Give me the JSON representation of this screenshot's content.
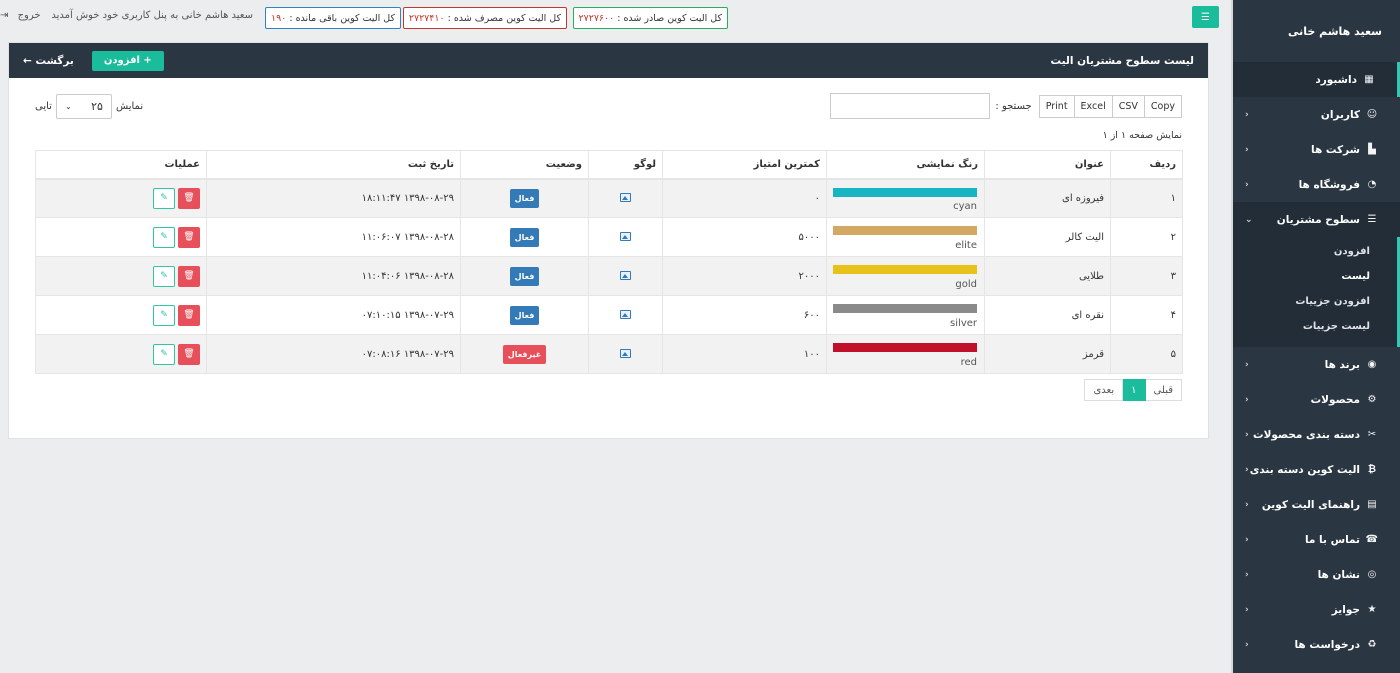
{
  "topbar": {
    "stat_issued_label": "کل الیت کوین صادر شده :",
    "stat_issued_value": "۲۷۲۷۶۰۰",
    "stat_used_label": "کل الیت کوین مصرف شده :",
    "stat_used_value": "۲۷۲۷۴۱۰",
    "stat_remaining_label": "کل الیت کوین باقی مانده :",
    "stat_remaining_value": "۱۹۰",
    "welcome": "سعید هاشم خانی به پنل کاربری خود خوش آمدید",
    "logout": "خروج"
  },
  "sidebar": {
    "user_name": "سعید هاشم خانی",
    "items": [
      {
        "label": "داشبورد",
        "icon": "▦"
      },
      {
        "label": "کاربران",
        "icon": "☺"
      },
      {
        "label": "شرکت ها",
        "icon": "▙"
      },
      {
        "label": "فروشگاه ها",
        "icon": "◔"
      },
      {
        "label": "سطوح مشتریان",
        "icon": "☰"
      },
      {
        "label": "برند ها",
        "icon": "◉"
      },
      {
        "label": "محصولات",
        "icon": "⚙"
      },
      {
        "label": "دسته بندی محصولات",
        "icon": "✂"
      },
      {
        "label": "الیت کوین دسته بندی",
        "icon": "₿"
      },
      {
        "label": "راهنمای الیت کوین",
        "icon": "▤"
      },
      {
        "label": "تماس با ما",
        "icon": "☎"
      },
      {
        "label": "نشان ها",
        "icon": "◎"
      },
      {
        "label": "جوایز",
        "icon": "★"
      },
      {
        "label": "درخواست ها",
        "icon": "♻"
      }
    ],
    "submenu": [
      "افزودن",
      "لیست",
      "افزودن جزییات",
      "لیست جزییات"
    ]
  },
  "panel": {
    "title": "لیست سطوح مشتریان الیت",
    "add_label": "+ افزودن",
    "back_label": "برگشت ←"
  },
  "tools": {
    "copy": "Copy",
    "csv": "CSV",
    "excel": "Excel",
    "print": "Print",
    "search_label": "جستجو :",
    "show_label": "نمایش",
    "show_value": "۲۵",
    "show_suffix": "تایی",
    "page_info": "نمایش صفحه ۱ از ۱"
  },
  "table": {
    "headers": [
      "ردیف",
      "عنوان",
      "رنگ نمایشی",
      "کمترین امتیاز",
      "لوگو",
      "وضعیت",
      "تاریخ ثبت",
      "عملیات"
    ],
    "rows": [
      {
        "num": "۱",
        "title": "فیروزه ای",
        "color": "#17b5c4",
        "color_name": "cyan",
        "min_score": "۰",
        "status": "فعال",
        "active": true,
        "date": "۱۳۹۸-۰۸-۲۹ ۱۸:۱۱:۴۷"
      },
      {
        "num": "۲",
        "title": "الیت کالر",
        "color": "#d3a863",
        "color_name": "elite",
        "min_score": "۵۰۰۰",
        "status": "فعال",
        "active": true,
        "date": "۱۳۹۸-۰۸-۲۸ ۱۱:۰۶:۰۷"
      },
      {
        "num": "۳",
        "title": "طلایی",
        "color": "#e6c21a",
        "color_name": "gold",
        "min_score": "۲۰۰۰",
        "status": "فعال",
        "active": true,
        "date": "۱۳۹۸-۰۸-۲۸ ۱۱:۰۴:۰۶"
      },
      {
        "num": "۴",
        "title": "نقره ای",
        "color": "#8a8a8a",
        "color_name": "silver",
        "min_score": "۶۰۰",
        "status": "فعال",
        "active": true,
        "date": "۱۳۹۸-۰۷-۲۹ ۰۷:۱۰:۱۵"
      },
      {
        "num": "۵",
        "title": "قرمز",
        "color": "#c0102a",
        "color_name": "red",
        "min_score": "۱۰۰",
        "status": "غیرفعال",
        "active": false,
        "date": "۱۳۹۸-۰۷-۲۹ ۰۷:۰۸:۱۶"
      }
    ]
  },
  "pager": {
    "prev": "قبلی",
    "current": "۱",
    "next": "بعدی"
  }
}
